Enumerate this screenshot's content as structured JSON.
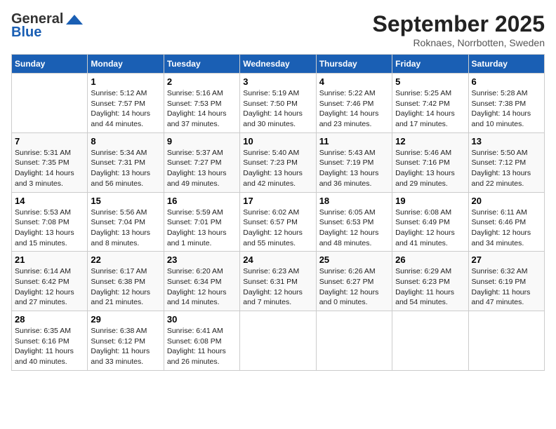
{
  "logo": {
    "general": "General",
    "blue": "Blue"
  },
  "title": "September 2025",
  "location": "Roknaes, Norrbotten, Sweden",
  "days_header": [
    "Sunday",
    "Monday",
    "Tuesday",
    "Wednesday",
    "Thursday",
    "Friday",
    "Saturday"
  ],
  "weeks": [
    [
      {
        "day": "",
        "info": ""
      },
      {
        "day": "1",
        "info": "Sunrise: 5:12 AM\nSunset: 7:57 PM\nDaylight: 14 hours\nand 44 minutes."
      },
      {
        "day": "2",
        "info": "Sunrise: 5:16 AM\nSunset: 7:53 PM\nDaylight: 14 hours\nand 37 minutes."
      },
      {
        "day": "3",
        "info": "Sunrise: 5:19 AM\nSunset: 7:50 PM\nDaylight: 14 hours\nand 30 minutes."
      },
      {
        "day": "4",
        "info": "Sunrise: 5:22 AM\nSunset: 7:46 PM\nDaylight: 14 hours\nand 23 minutes."
      },
      {
        "day": "5",
        "info": "Sunrise: 5:25 AM\nSunset: 7:42 PM\nDaylight: 14 hours\nand 17 minutes."
      },
      {
        "day": "6",
        "info": "Sunrise: 5:28 AM\nSunset: 7:38 PM\nDaylight: 14 hours\nand 10 minutes."
      }
    ],
    [
      {
        "day": "7",
        "info": "Sunrise: 5:31 AM\nSunset: 7:35 PM\nDaylight: 14 hours\nand 3 minutes."
      },
      {
        "day": "8",
        "info": "Sunrise: 5:34 AM\nSunset: 7:31 PM\nDaylight: 13 hours\nand 56 minutes."
      },
      {
        "day": "9",
        "info": "Sunrise: 5:37 AM\nSunset: 7:27 PM\nDaylight: 13 hours\nand 49 minutes."
      },
      {
        "day": "10",
        "info": "Sunrise: 5:40 AM\nSunset: 7:23 PM\nDaylight: 13 hours\nand 42 minutes."
      },
      {
        "day": "11",
        "info": "Sunrise: 5:43 AM\nSunset: 7:19 PM\nDaylight: 13 hours\nand 36 minutes."
      },
      {
        "day": "12",
        "info": "Sunrise: 5:46 AM\nSunset: 7:16 PM\nDaylight: 13 hours\nand 29 minutes."
      },
      {
        "day": "13",
        "info": "Sunrise: 5:50 AM\nSunset: 7:12 PM\nDaylight: 13 hours\nand 22 minutes."
      }
    ],
    [
      {
        "day": "14",
        "info": "Sunrise: 5:53 AM\nSunset: 7:08 PM\nDaylight: 13 hours\nand 15 minutes."
      },
      {
        "day": "15",
        "info": "Sunrise: 5:56 AM\nSunset: 7:04 PM\nDaylight: 13 hours\nand 8 minutes."
      },
      {
        "day": "16",
        "info": "Sunrise: 5:59 AM\nSunset: 7:01 PM\nDaylight: 13 hours\nand 1 minute."
      },
      {
        "day": "17",
        "info": "Sunrise: 6:02 AM\nSunset: 6:57 PM\nDaylight: 12 hours\nand 55 minutes."
      },
      {
        "day": "18",
        "info": "Sunrise: 6:05 AM\nSunset: 6:53 PM\nDaylight: 12 hours\nand 48 minutes."
      },
      {
        "day": "19",
        "info": "Sunrise: 6:08 AM\nSunset: 6:49 PM\nDaylight: 12 hours\nand 41 minutes."
      },
      {
        "day": "20",
        "info": "Sunrise: 6:11 AM\nSunset: 6:46 PM\nDaylight: 12 hours\nand 34 minutes."
      }
    ],
    [
      {
        "day": "21",
        "info": "Sunrise: 6:14 AM\nSunset: 6:42 PM\nDaylight: 12 hours\nand 27 minutes."
      },
      {
        "day": "22",
        "info": "Sunrise: 6:17 AM\nSunset: 6:38 PM\nDaylight: 12 hours\nand 21 minutes."
      },
      {
        "day": "23",
        "info": "Sunrise: 6:20 AM\nSunset: 6:34 PM\nDaylight: 12 hours\nand 14 minutes."
      },
      {
        "day": "24",
        "info": "Sunrise: 6:23 AM\nSunset: 6:31 PM\nDaylight: 12 hours\nand 7 minutes."
      },
      {
        "day": "25",
        "info": "Sunrise: 6:26 AM\nSunset: 6:27 PM\nDaylight: 12 hours\nand 0 minutes."
      },
      {
        "day": "26",
        "info": "Sunrise: 6:29 AM\nSunset: 6:23 PM\nDaylight: 11 hours\nand 54 minutes."
      },
      {
        "day": "27",
        "info": "Sunrise: 6:32 AM\nSunset: 6:19 PM\nDaylight: 11 hours\nand 47 minutes."
      }
    ],
    [
      {
        "day": "28",
        "info": "Sunrise: 6:35 AM\nSunset: 6:16 PM\nDaylight: 11 hours\nand 40 minutes."
      },
      {
        "day": "29",
        "info": "Sunrise: 6:38 AM\nSunset: 6:12 PM\nDaylight: 11 hours\nand 33 minutes."
      },
      {
        "day": "30",
        "info": "Sunrise: 6:41 AM\nSunset: 6:08 PM\nDaylight: 11 hours\nand 26 minutes."
      },
      {
        "day": "",
        "info": ""
      },
      {
        "day": "",
        "info": ""
      },
      {
        "day": "",
        "info": ""
      },
      {
        "day": "",
        "info": ""
      }
    ]
  ]
}
